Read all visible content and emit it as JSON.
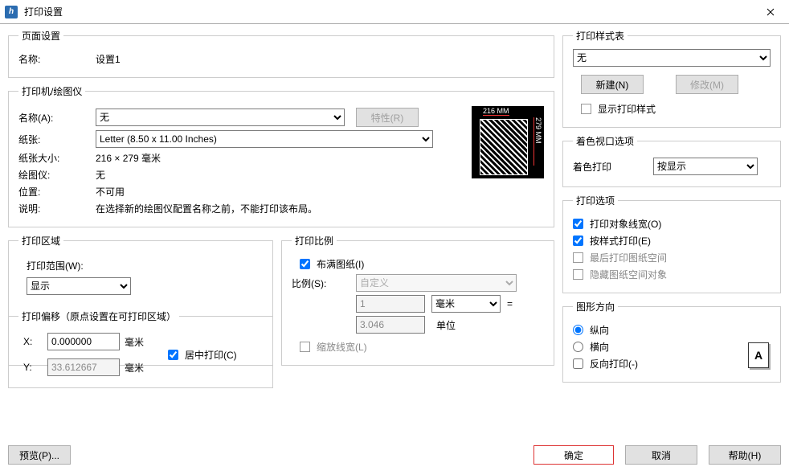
{
  "window": {
    "title": "打印设置"
  },
  "page_setup": {
    "legend": "页面设置",
    "name_label": "名称:",
    "name_value": "设置1"
  },
  "printer": {
    "legend": "打印机/绘图仪",
    "name_label": "名称(A):",
    "name_value": "无",
    "properties_btn": "特性(R)",
    "paper_label": "纸张:",
    "paper_value": "Letter (8.50 x 11.00 Inches)",
    "size_label": "纸张大小:",
    "size_value": "216 × 279  毫米",
    "plotter_label": "绘图仪:",
    "plotter_value": "无",
    "location_label": "位置:",
    "location_value": "不可用",
    "desc_label": "说明:",
    "desc_value": "在选择新的绘图仪配置名称之前，不能打印该布局。",
    "preview_top": "216 MM",
    "preview_side": "279 MM"
  },
  "print_area": {
    "legend": "打印区域",
    "range_label": "打印范围(W):",
    "range_value": "显示"
  },
  "print_scale": {
    "legend": "打印比例",
    "fit_label": "布满图纸(I)",
    "scale_label": "比例(S):",
    "scale_value": "自定义",
    "num1": "1",
    "unit_select": "毫米",
    "equals": "=",
    "num2": "3.046",
    "unit_text": "单位",
    "scale_lw": "缩放线宽(L)"
  },
  "print_offset": {
    "legend": "打印偏移（原点设置在可打印区域）",
    "x_label": "X:",
    "x_value": "0.000000",
    "y_label": "Y:",
    "y_value": "33.612667",
    "mm": "毫米",
    "center_label": "居中打印(C)"
  },
  "style": {
    "legend": "打印样式表",
    "value": "无",
    "new_btn": "新建(N)",
    "modify_btn": "修改(M)",
    "show_label": "显示打印样式"
  },
  "viewport": {
    "legend": "着色视口选项",
    "shade_label": "着色打印",
    "shade_value": "按显示"
  },
  "options": {
    "legend": "打印选项",
    "lineweight": "打印对象线宽(O)",
    "by_style": "按样式打印(E)",
    "last_paper": "最后打印图纸空间",
    "hide_paper": "隐藏图纸空间对象"
  },
  "orientation": {
    "legend": "图形方向",
    "portrait": "纵向",
    "landscape": "横向",
    "reverse": "反向打印(-)",
    "icon_letter": "A"
  },
  "buttons": {
    "preview": "预览(P)...",
    "ok": "确定",
    "cancel": "取消",
    "help": "帮助(H)"
  }
}
